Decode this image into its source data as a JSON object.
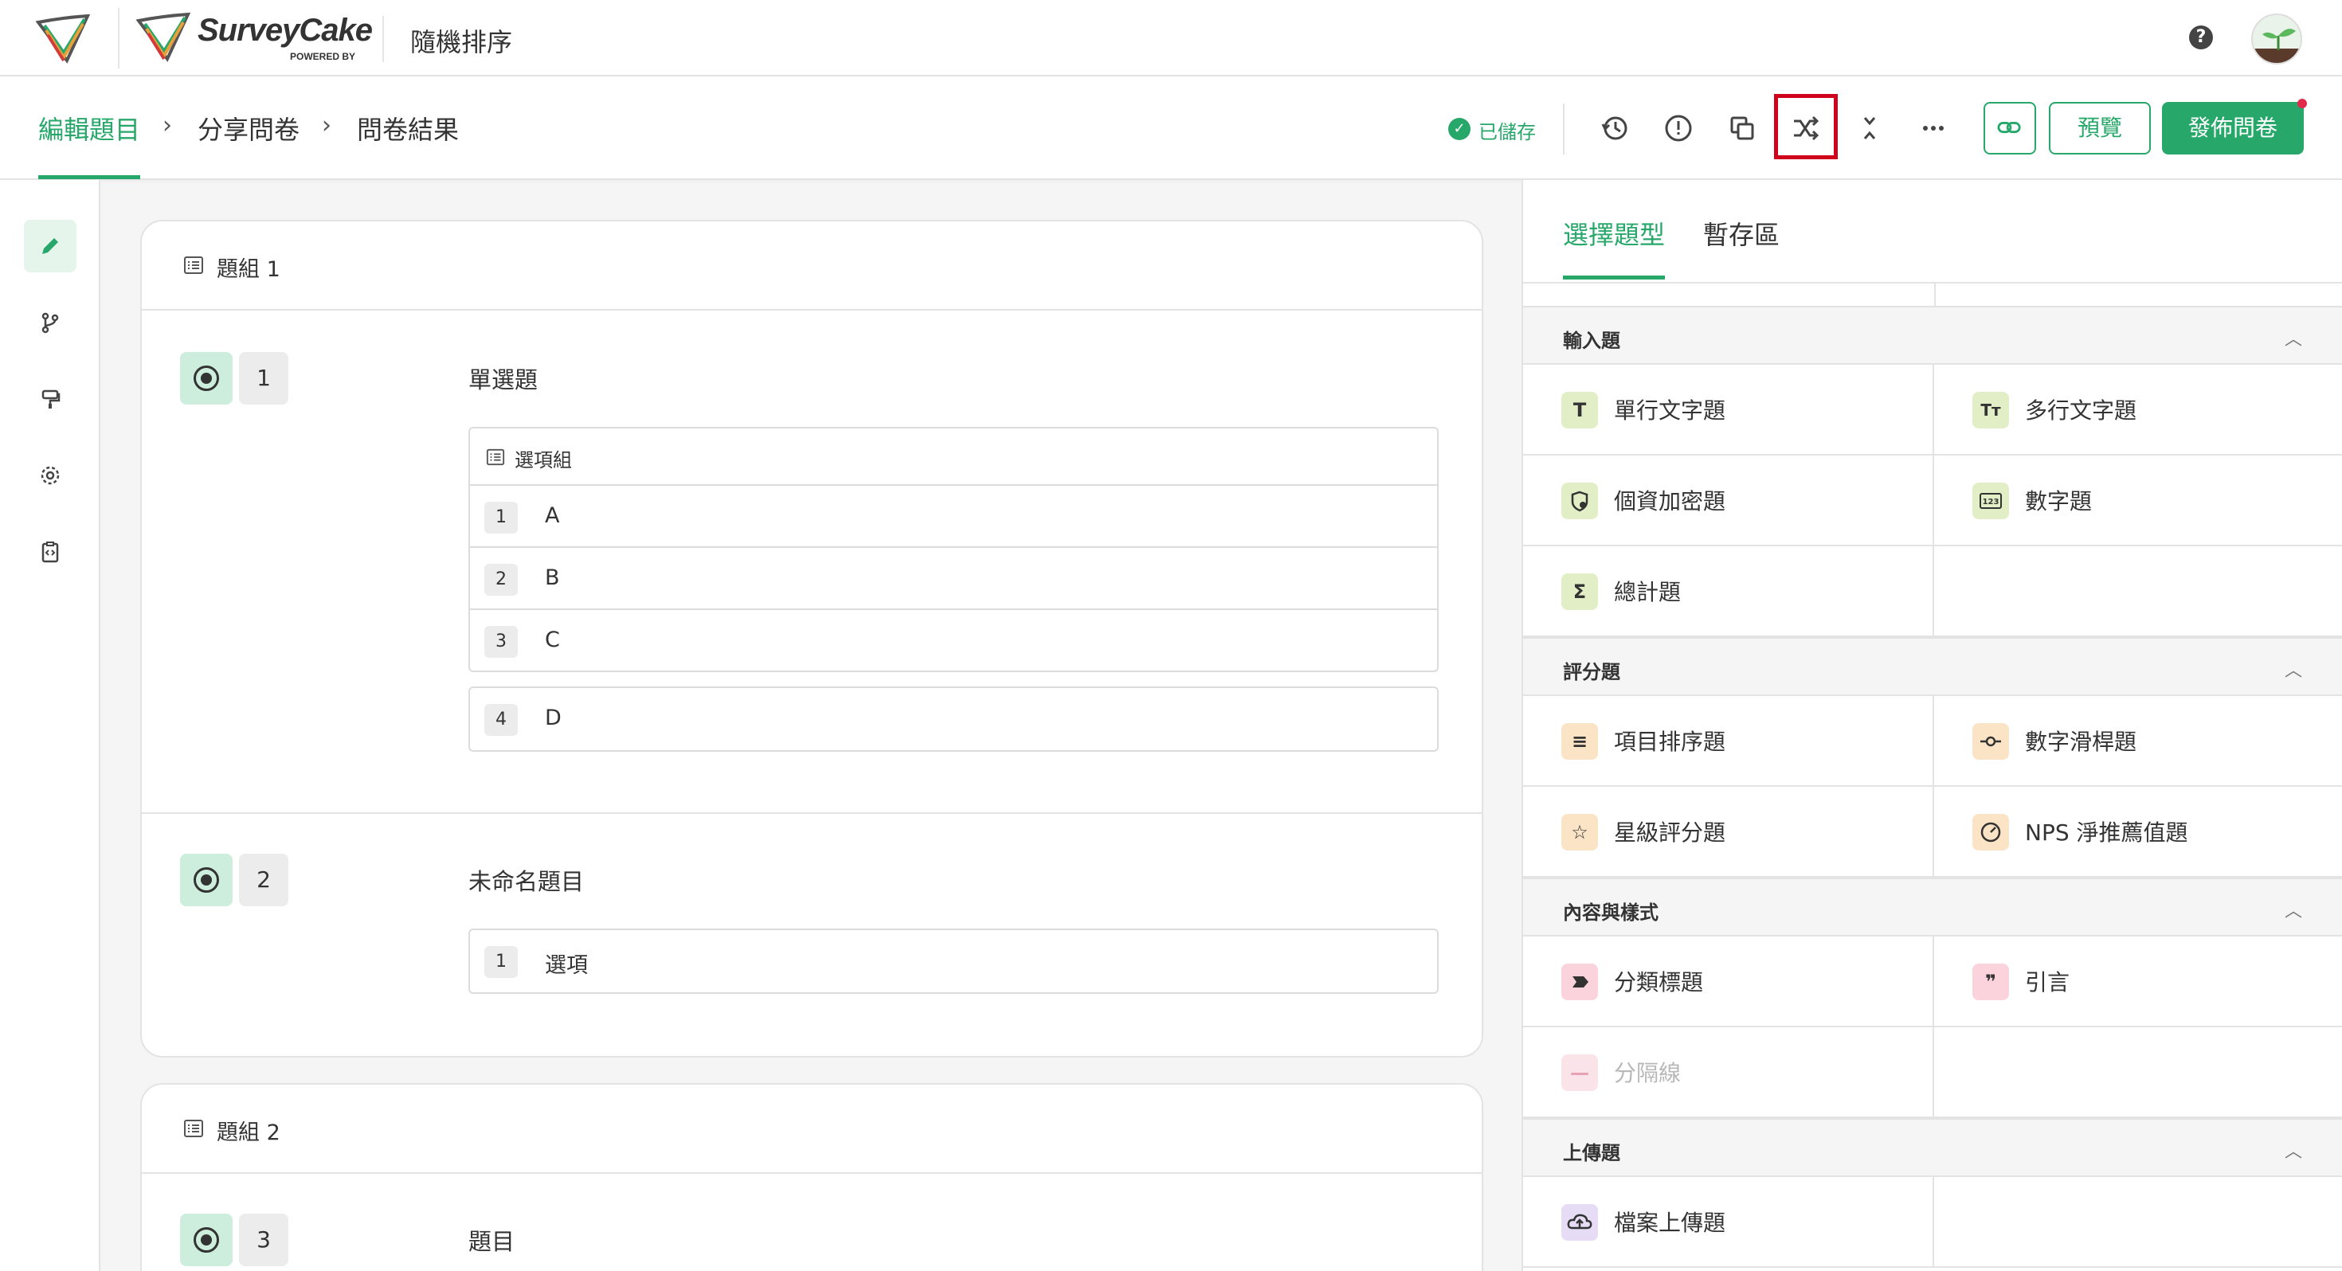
{
  "header": {
    "brand_name": "SurveyCake",
    "brand_sub": "POWERED BY",
    "survey_title": "隨機排序",
    "help_label": "?"
  },
  "nav": {
    "crumbs": [
      "編輯題目",
      "分享問卷",
      "問卷結果"
    ],
    "saved_label": "已儲存",
    "preview_label": "預覽",
    "publish_label": "發佈問卷"
  },
  "groups": [
    {
      "title": "題組 1",
      "questions": [
        {
          "num": "1",
          "title": "單選題",
          "option_group_label": "選項組",
          "grouped_options": [
            {
              "num": "1",
              "label": "A"
            },
            {
              "num": "2",
              "label": "B"
            },
            {
              "num": "3",
              "label": "C"
            }
          ],
          "extra_options": [
            {
              "num": "4",
              "label": "D"
            }
          ]
        },
        {
          "num": "2",
          "title": "未命名題目",
          "options": [
            {
              "num": "1",
              "label": "選項"
            }
          ]
        }
      ]
    },
    {
      "title": "題組 2",
      "questions": [
        {
          "num": "3",
          "title": "題目"
        }
      ]
    }
  ],
  "right_panel": {
    "tabs": [
      "選擇題型",
      "暫存區"
    ],
    "sections": [
      {
        "title": "輸入題",
        "items": [
          {
            "label": "單行文字題",
            "icon": "T"
          },
          {
            "label": "多行文字題",
            "icon": "Tт"
          },
          {
            "label": "個資加密題",
            "icon": "shield-lock-icon"
          },
          {
            "label": "數字題",
            "icon": "123"
          },
          {
            "label": "總計題",
            "icon": "Σ"
          }
        ]
      },
      {
        "title": "評分題",
        "items": [
          {
            "label": "項目排序題",
            "icon": "≡"
          },
          {
            "label": "數字滑桿題",
            "icon": "-o-"
          },
          {
            "label": "星級評分題",
            "icon": "☆"
          },
          {
            "label": "NPS 淨推薦值題",
            "icon": "gauge-icon"
          }
        ]
      },
      {
        "title": "內容與樣式",
        "items": [
          {
            "label": "分類標題",
            "icon": "tag-icon"
          },
          {
            "label": "引言",
            "icon": "❞"
          },
          {
            "label": "分隔線",
            "icon": "—"
          }
        ]
      },
      {
        "title": "上傳題",
        "items": [
          {
            "label": "檔案上傳題",
            "icon": "cloud-upload-icon"
          }
        ]
      }
    ]
  },
  "colors": {
    "accent": "#27a86a",
    "highlight": "#d0021b"
  }
}
